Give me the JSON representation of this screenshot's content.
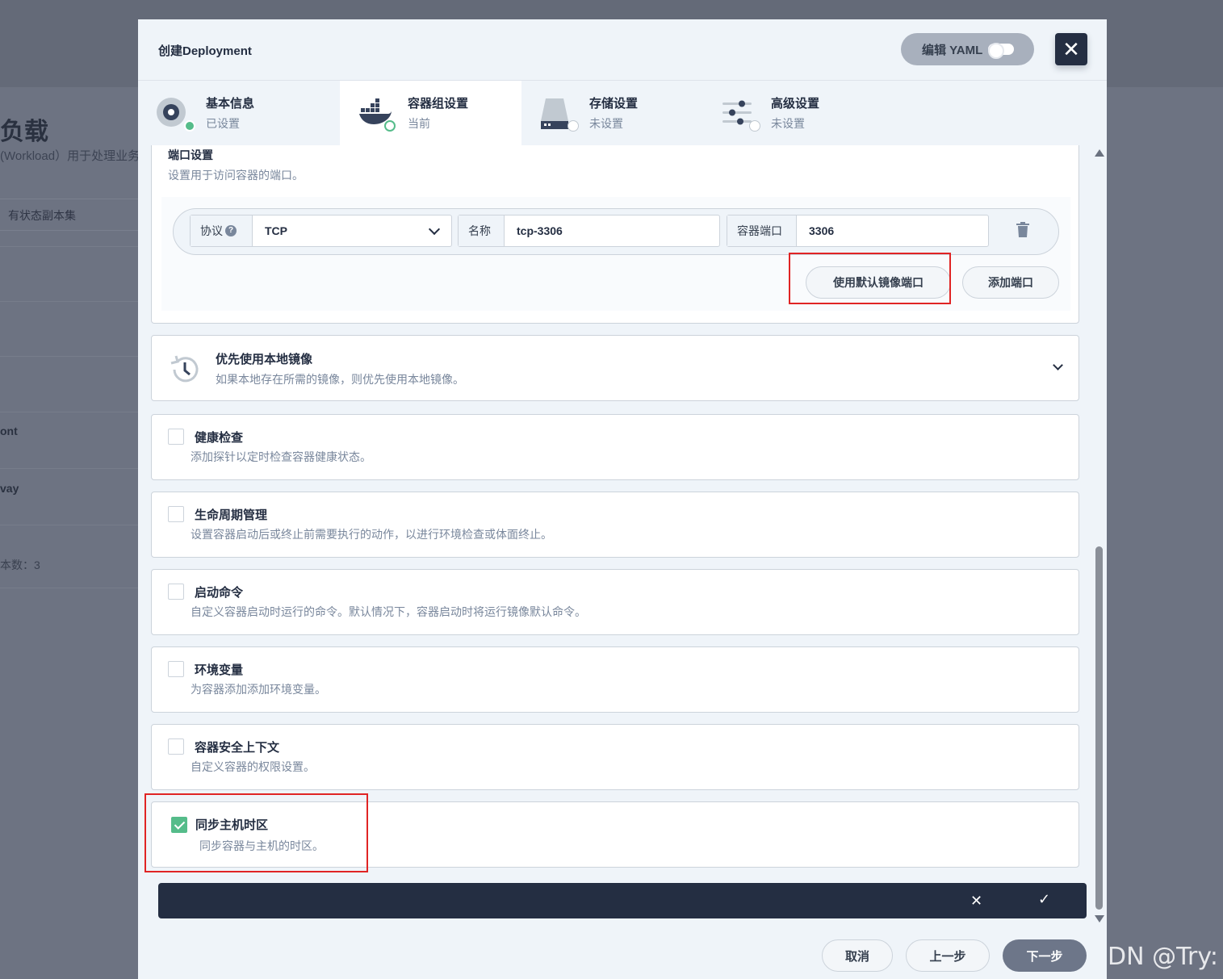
{
  "background": {
    "title": "负载",
    "desc": "(Workload）用于处理业务",
    "tab": "有状态副本集",
    "row_text_1": "ont",
    "row_text_2": "vay",
    "row_text_3": "本数：3"
  },
  "modal": {
    "title": "创建Deployment",
    "yaml_label": "编辑 YAML",
    "close_label": "✕"
  },
  "steps": [
    {
      "name": "基本信息",
      "state": "已设置",
      "icon": "disc-icon"
    },
    {
      "name": "容器组设置",
      "state": "当前",
      "icon": "docker-icon"
    },
    {
      "name": "存储设置",
      "state": "未设置",
      "icon": "storage-icon"
    },
    {
      "name": "高级设置",
      "state": "未设置",
      "icon": "sliders-icon"
    }
  ],
  "port_settings": {
    "title": "端口设置",
    "desc": "设置用于访问容器的端口。",
    "protocol_label": "协议",
    "protocol_value": "TCP",
    "name_label": "名称",
    "name_value": "tcp-3306",
    "container_port_label": "容器端口",
    "container_port_value": "3306",
    "use_default_button": "使用默认镜像端口",
    "add_port_button": "添加端口"
  },
  "local_image": {
    "title": "优先使用本地镜像",
    "desc": "如果本地存在所需的镜像，则优先使用本地镜像。"
  },
  "options": [
    {
      "title": "健康检查",
      "desc": "添加探针以定时检查容器健康状态。",
      "checked": false
    },
    {
      "title": "生命周期管理",
      "desc": "设置容器启动后或终止前需要执行的动作，以进行环境检查或体面终止。",
      "checked": false
    },
    {
      "title": "启动命令",
      "desc": "自定义容器启动时运行的命令。默认情况下，容器启动时将运行镜像默认命令。",
      "checked": false
    },
    {
      "title": "环境变量",
      "desc": "为容器添加添加环境变量。",
      "checked": false
    },
    {
      "title": "容器安全上下文",
      "desc": "自定义容器的权限设置。",
      "checked": false
    },
    {
      "title": "同步主机时区",
      "desc": "同步容器与主机的时区。",
      "checked": true
    }
  ],
  "edit_bar": {
    "cancel": "✕",
    "confirm": "✓"
  },
  "footer": {
    "cancel": "取消",
    "prev": "上一步",
    "next": "下一步"
  },
  "watermark": "CSDN @Try:",
  "colors": {
    "accent": "#55bc8a",
    "dark": "#242e42",
    "highlight": "#e02424"
  }
}
